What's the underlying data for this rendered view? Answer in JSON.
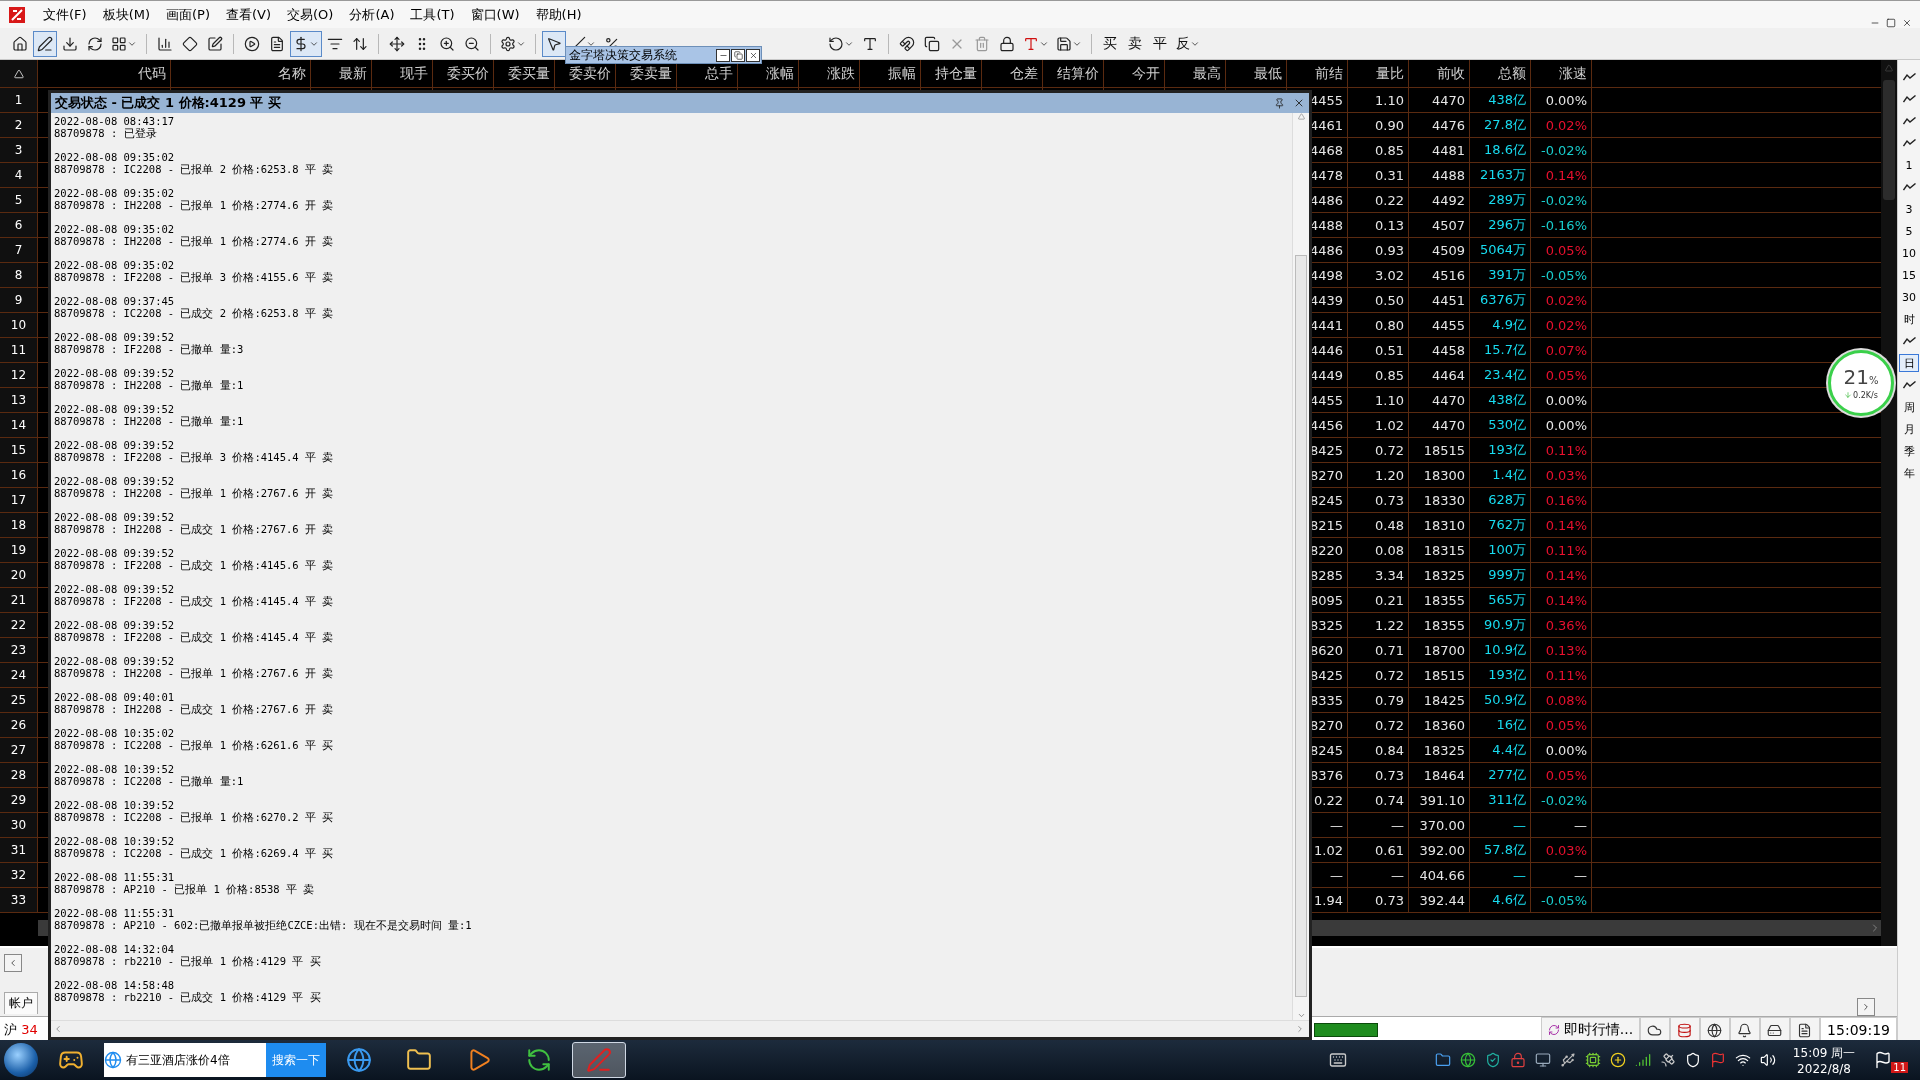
{
  "menu": [
    "文件(F)",
    "板块(M)",
    "画面(P)",
    "查看(V)",
    "交易(O)",
    "分析(A)",
    "工具(T)",
    "窗口(W)",
    "帮助(H)"
  ],
  "toolbar": {
    "left": [
      {
        "selected": false
      },
      {
        "selected": true
      },
      {
        "selected": false
      },
      {
        "selected": false
      },
      {
        "selected": false
      },
      {
        "selected": false
      },
      {
        "selected": false
      },
      {
        "selected": false
      },
      {
        "selected": false
      },
      {
        "selected": false
      },
      {
        "selected": true
      },
      {
        "selected": false
      },
      {
        "selected": false
      },
      {
        "selected": false
      },
      {
        "selected": false
      },
      {
        "selected": false
      },
      {
        "selected": false
      },
      {
        "selected": false
      },
      {
        "selected": true
      },
      {
        "selected": false
      },
      {
        "selected": false
      }
    ],
    "right": [
      {
        "kind": "icon",
        "selected": false
      },
      {
        "kind": "icon",
        "selected": false
      },
      {
        "kind": "icon",
        "selected": false
      },
      {
        "kind": "icon",
        "selected": false
      },
      {
        "kind": "icon",
        "selected": false
      },
      {
        "kind": "icon",
        "selected": false
      },
      {
        "kind": "icon",
        "selected": false
      },
      {
        "kind": "icon",
        "selected": false
      },
      {
        "kind": "icon",
        "selected": false
      },
      {
        "kind": "text",
        "label": "买",
        "selected": false
      },
      {
        "kind": "text",
        "label": "卖",
        "selected": false
      },
      {
        "kind": "text",
        "label": "平",
        "selected": false
      },
      {
        "kind": "text",
        "label": "反",
        "selected": false
      }
    ]
  },
  "mini_window": {
    "title": "金字塔决策交易系统"
  },
  "table": {
    "columns": [
      "代码",
      "名称",
      "最新",
      "现手",
      "委买价",
      "委买量",
      "委卖价",
      "委卖量",
      "总手",
      "涨幅",
      "涨跌",
      "振幅",
      "持仓量",
      "仓差",
      "结算价",
      "今开",
      "最高",
      "最低",
      "前结",
      "量比",
      "前收",
      "总额",
      "涨速"
    ],
    "rows": [
      {
        "no": "1",
        "prev_settle": "4455",
        "volume_ratio": "1.10",
        "prev_close": "4470",
        "turnover": "438亿",
        "speed": "0.00%",
        "color": "#e6e6e6"
      },
      {
        "no": "2",
        "prev_settle": "4461",
        "volume_ratio": "0.90",
        "prev_close": "4476",
        "turnover": "27.8亿",
        "speed": "0.02%",
        "color": "#e8102e"
      },
      {
        "no": "3",
        "prev_settle": "4468",
        "volume_ratio": "0.85",
        "prev_close": "4481",
        "turnover": "18.6亿",
        "speed": "-0.02%",
        "color": "#18cccc"
      },
      {
        "no": "4",
        "prev_settle": "4478",
        "volume_ratio": "0.31",
        "prev_close": "4488",
        "turnover": "2163万",
        "speed": "0.14%",
        "color": "#e8102e"
      },
      {
        "no": "5",
        "prev_settle": "4486",
        "volume_ratio": "0.22",
        "prev_close": "4492",
        "turnover": "289万",
        "speed": "-0.02%",
        "color": "#18cccc"
      },
      {
        "no": "6",
        "prev_settle": "4488",
        "volume_ratio": "0.13",
        "prev_close": "4507",
        "turnover": "296万",
        "speed": "-0.16%",
        "color": "#18cccc"
      },
      {
        "no": "7",
        "prev_settle": "4486",
        "volume_ratio": "0.93",
        "prev_close": "4509",
        "turnover": "5064万",
        "speed": "0.05%",
        "color": "#e8102e"
      },
      {
        "no": "8",
        "prev_settle": "4498",
        "volume_ratio": "3.02",
        "prev_close": "4516",
        "turnover": "391万",
        "speed": "-0.05%",
        "color": "#18cccc"
      },
      {
        "no": "9",
        "prev_settle": "4439",
        "volume_ratio": "0.50",
        "prev_close": "4451",
        "turnover": "6376万",
        "speed": "0.02%",
        "color": "#e8102e"
      },
      {
        "no": "10",
        "prev_settle": "4441",
        "volume_ratio": "0.80",
        "prev_close": "4455",
        "turnover": "4.9亿",
        "speed": "0.02%",
        "color": "#e8102e"
      },
      {
        "no": "11",
        "prev_settle": "4446",
        "volume_ratio": "0.51",
        "prev_close": "4458",
        "turnover": "15.7亿",
        "speed": "0.07%",
        "color": "#e8102e"
      },
      {
        "no": "12",
        "prev_settle": "4449",
        "volume_ratio": "0.85",
        "prev_close": "4464",
        "turnover": "23.4亿",
        "speed": "0.05%",
        "color": "#e8102e"
      },
      {
        "no": "13",
        "prev_settle": "4455",
        "volume_ratio": "1.10",
        "prev_close": "4470",
        "turnover": "438亿",
        "speed": "0.00%",
        "color": "#e6e6e6"
      },
      {
        "no": "14",
        "prev_settle": "4456",
        "volume_ratio": "1.02",
        "prev_close": "4470",
        "turnover": "530亿",
        "speed": "0.00%",
        "color": "#e6e6e6"
      },
      {
        "no": "15",
        "prev_settle": "8425",
        "volume_ratio": "0.72",
        "prev_close": "18515",
        "turnover": "193亿",
        "speed": "0.11%",
        "color": "#e8102e"
      },
      {
        "no": "16",
        "prev_settle": "8270",
        "volume_ratio": "1.20",
        "prev_close": "18300",
        "turnover": "1.4亿",
        "speed": "0.03%",
        "color": "#e8102e"
      },
      {
        "no": "17",
        "prev_settle": "8245",
        "volume_ratio": "0.73",
        "prev_close": "18330",
        "turnover": "628万",
        "speed": "0.16%",
        "color": "#e8102e"
      },
      {
        "no": "18",
        "prev_settle": "8215",
        "volume_ratio": "0.48",
        "prev_close": "18310",
        "turnover": "762万",
        "speed": "0.14%",
        "color": "#e8102e"
      },
      {
        "no": "19",
        "prev_settle": "8220",
        "volume_ratio": "0.08",
        "prev_close": "18315",
        "turnover": "100万",
        "speed": "0.11%",
        "color": "#e8102e"
      },
      {
        "no": "20",
        "prev_settle": "8285",
        "volume_ratio": "3.34",
        "prev_close": "18325",
        "turnover": "999万",
        "speed": "0.14%",
        "color": "#e8102e"
      },
      {
        "no": "21",
        "prev_settle": "8095",
        "volume_ratio": "0.21",
        "prev_close": "18355",
        "turnover": "565万",
        "speed": "0.14%",
        "color": "#e8102e"
      },
      {
        "no": "22",
        "prev_settle": "8325",
        "volume_ratio": "1.22",
        "prev_close": "18355",
        "turnover": "90.9万",
        "speed": "0.36%",
        "color": "#e8102e"
      },
      {
        "no": "23",
        "prev_settle": "8620",
        "volume_ratio": "0.71",
        "prev_close": "18700",
        "turnover": "10.9亿",
        "speed": "0.13%",
        "color": "#e8102e"
      },
      {
        "no": "24",
        "prev_settle": "8425",
        "volume_ratio": "0.72",
        "prev_close": "18515",
        "turnover": "193亿",
        "speed": "0.11%",
        "color": "#e8102e"
      },
      {
        "no": "25",
        "prev_settle": "8335",
        "volume_ratio": "0.79",
        "prev_close": "18425",
        "turnover": "50.9亿",
        "speed": "0.08%",
        "color": "#e8102e"
      },
      {
        "no": "26",
        "prev_settle": "8270",
        "volume_ratio": "0.72",
        "prev_close": "18360",
        "turnover": "16亿",
        "speed": "0.05%",
        "color": "#e8102e"
      },
      {
        "no": "27",
        "prev_settle": "8245",
        "volume_ratio": "0.84",
        "prev_close": "18325",
        "turnover": "4.4亿",
        "speed": "0.00%",
        "color": "#e6e6e6"
      },
      {
        "no": "28",
        "prev_settle": "8376",
        "volume_ratio": "0.73",
        "prev_close": "18464",
        "turnover": "277亿",
        "speed": "0.05%",
        "color": "#e8102e"
      },
      {
        "no": "29",
        "prev_settle": "0.22",
        "volume_ratio": "0.74",
        "prev_close": "391.10",
        "turnover": "311亿",
        "speed": "-0.02%",
        "color": "#18cccc"
      },
      {
        "no": "30",
        "prev_settle": "—",
        "volume_ratio": "—",
        "prev_close": "370.00",
        "turnover": "—",
        "speed": "—"
      },
      {
        "no": "31",
        "prev_settle": "1.02",
        "volume_ratio": "0.61",
        "prev_close": "392.00",
        "turnover": "57.8亿",
        "speed": "0.03%",
        "color": "#e8102e"
      },
      {
        "no": "32",
        "prev_settle": "—",
        "volume_ratio": "—",
        "prev_close": "404.66",
        "turnover": "—",
        "speed": "—"
      },
      {
        "no": "33",
        "prev_settle": "1.94",
        "volume_ratio": "0.73",
        "prev_close": "392.44",
        "turnover": "4.6亿",
        "speed": "-0.05%",
        "color": "#18cccc"
      }
    ]
  },
  "period_bar": [
    {
      "kind": "icon"
    },
    {
      "kind": "icon"
    },
    {
      "kind": "icon"
    },
    {
      "kind": "icon"
    },
    {
      "kind": "text",
      "label": "1",
      "selected": false
    },
    {
      "kind": "icon"
    },
    {
      "kind": "text",
      "label": "3",
      "selected": false
    },
    {
      "kind": "text",
      "label": "5",
      "selected": false
    },
    {
      "kind": "text",
      "label": "10",
      "selected": false
    },
    {
      "kind": "text",
      "label": "15",
      "selected": false
    },
    {
      "kind": "text",
      "label": "30",
      "selected": false
    },
    {
      "kind": "text",
      "label": "时",
      "selected": false
    },
    {
      "kind": "icon"
    },
    {
      "kind": "text",
      "label": "日",
      "selected": true
    },
    {
      "kind": "icon"
    },
    {
      "kind": "text",
      "label": "周",
      "selected": false
    },
    {
      "kind": "text",
      "label": "月",
      "selected": false
    },
    {
      "kind": "text",
      "label": "季",
      "selected": false
    },
    {
      "kind": "text",
      "label": "年",
      "selected": false
    }
  ],
  "speed_widget": {
    "percent": "21",
    "unit": "%",
    "rate": "0.2K/s"
  },
  "dialog": {
    "title": "交易状态 - 已成交 1 价格:4129 平 买",
    "log": [
      {
        "time": "2022-08-08 08:43:17",
        "message": "88709878 : 已登录"
      },
      {
        "time": "2022-08-08 09:35:02",
        "message": "88709878 : IC2208 - 已报单 2 价格:6253.8 平 卖"
      },
      {
        "time": "2022-08-08 09:35:02",
        "message": "88709878 : IH2208 - 已报单 1 价格:2774.6 开 卖"
      },
      {
        "time": "2022-08-08 09:35:02",
        "message": "88709878 : IH2208 - 已报单 1 价格:2774.6 开 卖"
      },
      {
        "time": "2022-08-08 09:35:02",
        "message": "88709878 : IF2208 - 已报单 3 价格:4155.6 平 卖"
      },
      {
        "time": "2022-08-08 09:37:45",
        "message": "88709878 : IC2208 - 已成交 2 价格:6253.8 平 卖"
      },
      {
        "time": "2022-08-08 09:39:52",
        "message": "88709878 : IF2208 - 已撤单 量:3"
      },
      {
        "time": "2022-08-08 09:39:52",
        "message": "88709878 : IH2208 - 已撤单 量:1"
      },
      {
        "time": "2022-08-08 09:39:52",
        "message": "88709878 : IH2208 - 已撤单 量:1"
      },
      {
        "time": "2022-08-08 09:39:52",
        "message": "88709878 : IF2208 - 已报单 3 价格:4145.4 平 卖"
      },
      {
        "time": "2022-08-08 09:39:52",
        "message": "88709878 : IH2208 - 已报单 1 价格:2767.6 开 卖"
      },
      {
        "time": "2022-08-08 09:39:52",
        "message": "88709878 : IH2208 - 已成交 1 价格:2767.6 开 卖"
      },
      {
        "time": "2022-08-08 09:39:52",
        "message": "88709878 : IF2208 - 已成交 1 价格:4145.6 平 卖"
      },
      {
        "time": "2022-08-08 09:39:52",
        "message": "88709878 : IF2208 - 已成交 1 价格:4145.4 平 卖"
      },
      {
        "time": "2022-08-08 09:39:52",
        "message": "88709878 : IF2208 - 已成交 1 价格:4145.4 平 卖"
      },
      {
        "time": "2022-08-08 09:39:52",
        "message": "88709878 : IH2208 - 已报单 1 价格:2767.6 开 卖"
      },
      {
        "time": "2022-08-08 09:40:01",
        "message": "88709878 : IH2208 - 已成交 1 价格:2767.6 开 卖"
      },
      {
        "time": "2022-08-08 10:35:02",
        "message": "88709878 : IC2208 - 已报单 1 价格:6261.6 平 买"
      },
      {
        "time": "2022-08-08 10:39:52",
        "message": "88709878 : IC2208 - 已撤单 量:1"
      },
      {
        "time": "2022-08-08 10:39:52",
        "message": "88709878 : IC2208 - 已报单 1 价格:6270.2 平 买"
      },
      {
        "time": "2022-08-08 10:39:52",
        "message": "88709878 : IC2208 - 已成交 1 价格:6269.4 平 买"
      },
      {
        "time": "2022-08-08 11:55:31",
        "message": "88709878 : AP210 - 已报单 1 价格:8538 平 卖"
      },
      {
        "time": "2022-08-08 11:55:31",
        "message": "88709878 : AP210 - 602:已撤单报单被拒绝CZCE:出错: 现在不是交易时间 量:1"
      },
      {
        "time": "2022-08-08 14:32:04",
        "message": "88709878 : rb2210 - 已报单 1 价格:4129 平 买"
      },
      {
        "time": "2022-08-08 14:58:48",
        "message": "88709878 : rb2210 - 已成交 1 价格:4129 平 买"
      }
    ]
  },
  "account_tab": "帐户",
  "status_bar": {
    "market": "沪",
    "count": "34",
    "quote_button": "即时行情...",
    "time": "15:09:19"
  },
  "taskbar": {
    "apps": [
      {
        "active": false
      },
      {
        "active": false
      },
      {
        "active": false
      },
      {
        "active": false
      },
      {
        "active": false
      },
      {
        "active": true
      }
    ],
    "search": {
      "text": "有三亚酒店涨价4倍",
      "button": "搜索一下"
    },
    "clock": {
      "time": "15:09 周一",
      "date": "2022/8/8"
    },
    "notifications": "11"
  }
}
